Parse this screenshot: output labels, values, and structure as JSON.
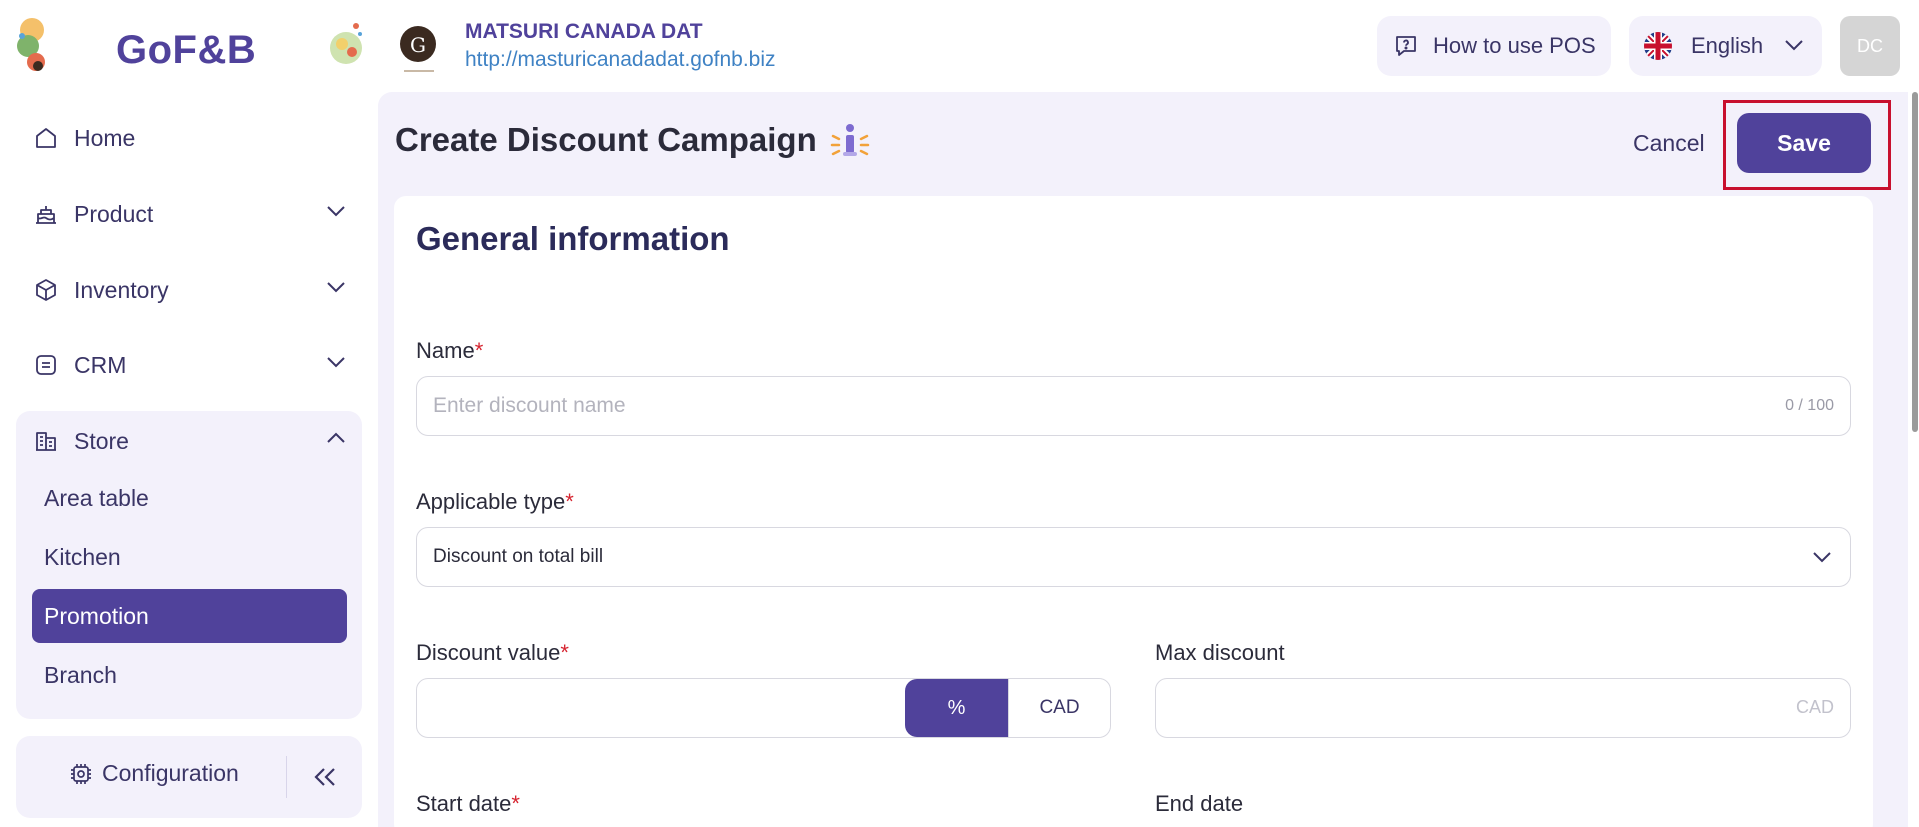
{
  "brand": {
    "logo_text": "GoF&B"
  },
  "store": {
    "name": "MATSURI CANADA DAT",
    "url": "http://masturicanadadat.gofnb.biz"
  },
  "header": {
    "how_to_label": "How to use POS",
    "language_label": "English",
    "avatar_initials": "DC"
  },
  "sidebar": {
    "items": [
      {
        "label": "Home",
        "icon": "home-icon"
      },
      {
        "label": "Product",
        "icon": "cake-icon"
      },
      {
        "label": "Inventory",
        "icon": "box-icon"
      },
      {
        "label": "CRM",
        "icon": "crm-icon"
      },
      {
        "label": "Store",
        "icon": "store-icon"
      }
    ],
    "store_sub_items": [
      "Area table",
      "Kitchen",
      "Promotion",
      "Branch"
    ],
    "active_sub_item": "Promotion",
    "configuration_label": "Configuration"
  },
  "page": {
    "title": "Create Discount Campaign",
    "cancel_label": "Cancel",
    "save_label": "Save"
  },
  "form": {
    "section_title": "General information",
    "name_label": "Name",
    "name_placeholder": "Enter discount name",
    "name_counter": "0 / 100",
    "applicable_type_label": "Applicable type",
    "applicable_type_value": "Discount on total bill",
    "discount_value_label": "Discount value",
    "discount_unit_percent": "%",
    "discount_unit_currency": "CAD",
    "max_discount_label": "Max discount",
    "max_discount_unit": "CAD",
    "start_date_label": "Start date",
    "end_date_label": "End date",
    "required_mark": "*"
  },
  "colors": {
    "primary": "#50429b",
    "accent_bg": "#f3f1fb",
    "required": "#d6232f",
    "highlight_outline": "#c8102e",
    "link": "#3f82c4"
  }
}
